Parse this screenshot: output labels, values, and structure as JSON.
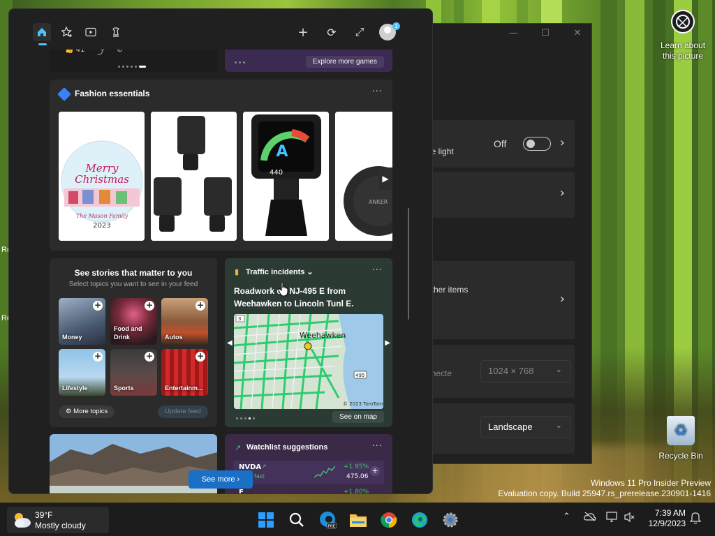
{
  "desktop": {
    "learn_about": "Learn about this picture",
    "recycle_bin": "Recycle Bin",
    "watermark_line1": "Windows 11 Pro Insider Preview",
    "watermark_line2": "Evaluation copy. Build 25947.rs_prerelease.230901-1416",
    "edge_text_1": "Ro",
    "edge_text_2": "Re"
  },
  "settings": {
    "toggle_state": "Off",
    "row1_label": "ue light",
    "row3_label": "other items",
    "resolution_label": "nnecte",
    "resolution_value": "1024 × 768",
    "orientation_value": "Landscape"
  },
  "widgets": {
    "toolbar": {
      "home_icon": "home-icon",
      "favorites_icon": "star-add-icon",
      "video_icon": "video-icon",
      "games_icon": "chess-icon",
      "add_icon": "plus-icon",
      "refresh_icon": "refresh-icon",
      "expand_icon": "expand-icon",
      "profile_badge": "1"
    },
    "top_left": {
      "likes": "41"
    },
    "top_right": {
      "explore_label": "Explore more games"
    },
    "fashion": {
      "title": "Fashion essentials",
      "more": "···"
    },
    "stories": {
      "title": "See stories that matter to you",
      "subtitle": "Select topics you want to see in your feed",
      "topics": [
        {
          "label": "Money"
        },
        {
          "label": "Food and Drink"
        },
        {
          "label": "Autos"
        },
        {
          "label": "Lifestyle"
        },
        {
          "label": "Sports"
        },
        {
          "label": "Entertainm..."
        }
      ],
      "more_topics": "More topics",
      "update_feed": "Update feed"
    },
    "traffic": {
      "title": "Traffic incidents",
      "headline": "Roadwork on NJ-495 E from Weehawken to Lincoln Tunl E.",
      "map_city": "Weehawken",
      "map_copyright": "© 2023 TomTom",
      "see_on_map": "See on map",
      "more": "···"
    },
    "watchlist": {
      "title": "Watchlist suggestions",
      "ticker": "NVDA",
      "sub": "fast",
      "change": "+1.95%",
      "price": "475.06",
      "ticker2": "F",
      "change2": "+1.80%",
      "more": "···"
    },
    "see_more": "See more"
  },
  "taskbar": {
    "temp": "39°F",
    "condition": "Mostly cloudy",
    "time": "7:39 AM",
    "date": "12/9/2023",
    "pins": [
      "start-icon",
      "search-icon",
      "edge-beta-icon",
      "file-explorer-icon",
      "chrome-icon",
      "edge-icon",
      "settings-icon"
    ]
  },
  "colors": {
    "accent": "#4cc2ff",
    "see_more_bg": "#1a6fc7",
    "traffic_green": "#2ecc71"
  }
}
